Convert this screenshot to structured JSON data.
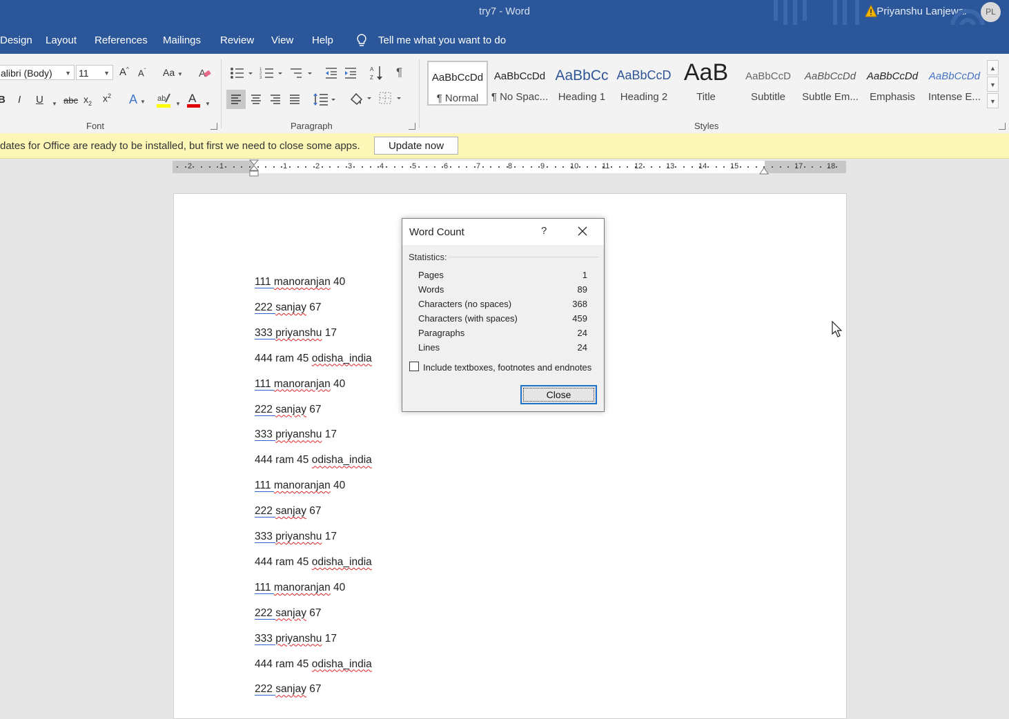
{
  "window": {
    "title": "try7  -  Word",
    "user_name": "Priyanshu Lanjewar",
    "user_initials": "PL"
  },
  "tabs": [
    {
      "label": "Design"
    },
    {
      "label": "Layout"
    },
    {
      "label": "References"
    },
    {
      "label": "Mailings"
    },
    {
      "label": "Review"
    },
    {
      "label": "View"
    },
    {
      "label": "Help"
    }
  ],
  "tell_me": "Tell me what you want to do",
  "font_group": {
    "font_name": "alibri (Body)",
    "font_size": "11",
    "label": "Font"
  },
  "paragraph_group": {
    "label": "Paragraph"
  },
  "styles_group": {
    "label": "Styles",
    "styles": [
      {
        "sample": "AaBbCcDd",
        "name": "¶ Normal"
      },
      {
        "sample": "AaBbCcDd",
        "name": "¶ No Spac..."
      },
      {
        "sample": "AaBbCc",
        "name": "Heading 1"
      },
      {
        "sample": "AaBbCcD",
        "name": "Heading 2"
      },
      {
        "sample": "AaB",
        "name": "Title"
      },
      {
        "sample": "AaBbCcD",
        "name": "Subtitle"
      },
      {
        "sample": "AaBbCcDd",
        "name": "Subtle Em..."
      },
      {
        "sample": "AaBbCcDd",
        "name": "Emphasis"
      },
      {
        "sample": "AaBbCcDd",
        "name": "Intense E..."
      }
    ]
  },
  "update_bar": {
    "message": "dates for Office are ready to be installed, but first we need to close some apps.",
    "button": "Update now"
  },
  "ruler": {
    "left_numbers": [
      "2",
      "1"
    ],
    "right_numbers": [
      "1",
      "2",
      "3",
      "4",
      "5",
      "6",
      "7",
      "8",
      "9",
      "10",
      "11",
      "12",
      "13",
      "14",
      "15",
      "17",
      "18"
    ]
  },
  "document": {
    "lines": [
      {
        "num": "111",
        "name": "manoranjan",
        "rest": " 40",
        "kind": "a"
      },
      {
        "num": "222",
        "name": "sanjay",
        "rest": " 67",
        "kind": "a"
      },
      {
        "num": "333",
        "name": "priyanshu",
        "rest": " 17",
        "kind": "a"
      },
      {
        "num": "444 ram 45 ",
        "name": "odisha_india",
        "rest": "",
        "kind": "b"
      },
      {
        "num": "111",
        "name": "manoranjan",
        "rest": " 40",
        "kind": "a"
      },
      {
        "num": "222",
        "name": "sanjay",
        "rest": " 67",
        "kind": "a"
      },
      {
        "num": "333",
        "name": "priyanshu",
        "rest": " 17",
        "kind": "a"
      },
      {
        "num": "444 ram 45 ",
        "name": "odisha_india",
        "rest": "",
        "kind": "b"
      },
      {
        "num": "111",
        "name": "manoranjan",
        "rest": " 40",
        "kind": "a"
      },
      {
        "num": "222",
        "name": "sanjay",
        "rest": " 67",
        "kind": "a"
      },
      {
        "num": "333",
        "name": "priyanshu",
        "rest": " 17",
        "kind": "a"
      },
      {
        "num": "444 ram 45 ",
        "name": "odisha_india",
        "rest": "",
        "kind": "b"
      },
      {
        "num": "111",
        "name": "manoranjan",
        "rest": " 40",
        "kind": "a"
      },
      {
        "num": "222",
        "name": "sanjay",
        "rest": " 67",
        "kind": "a"
      },
      {
        "num": "333",
        "name": "priyanshu",
        "rest": " 17",
        "kind": "a"
      },
      {
        "num": "444 ram 45 ",
        "name": "odisha_india",
        "rest": "",
        "kind": "b"
      },
      {
        "num": "222",
        "name": "sanjay",
        "rest": " 67",
        "kind": "a"
      }
    ]
  },
  "word_count_dialog": {
    "title": "Word Count",
    "help": "?",
    "statistics_label": "Statistics:",
    "stats": [
      {
        "label": "Pages",
        "value": "1"
      },
      {
        "label": "Words",
        "value": "89"
      },
      {
        "label": "Characters (no spaces)",
        "value": "368"
      },
      {
        "label": "Characters (with spaces)",
        "value": "459"
      },
      {
        "label": "Paragraphs",
        "value": "24"
      },
      {
        "label": "Lines",
        "value": "24"
      }
    ],
    "checkbox_label": "Include textboxes, footnotes and endnotes",
    "checkbox_checked": false,
    "close_button": "Close"
  },
  "colors": {
    "title_bar": "#2b579a",
    "ribbon": "#f3f3f3",
    "update_bar": "#fcf7b6",
    "highlight_yellow": "#ffff00",
    "font_color_red": "#e00000",
    "dialog_focus": "#1a73c8"
  }
}
